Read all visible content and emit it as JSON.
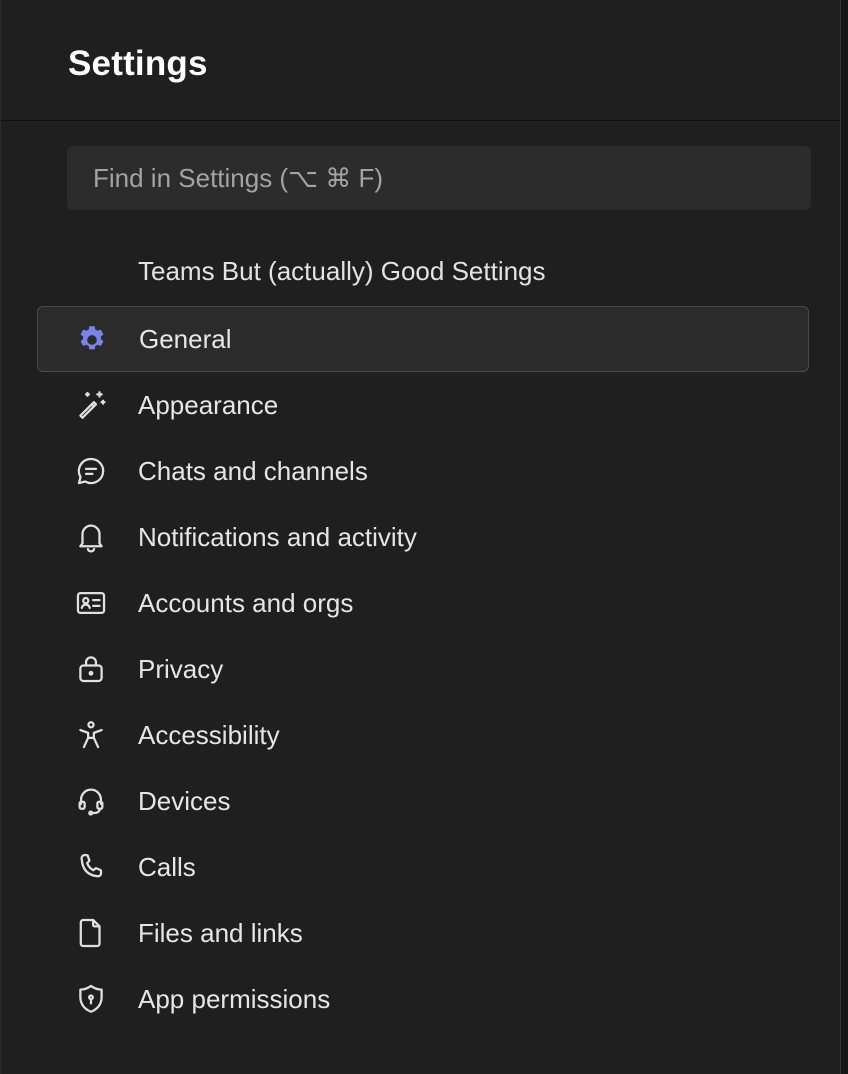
{
  "header": {
    "title": "Settings"
  },
  "search": {
    "placeholder": "Find in Settings (⌥ ⌘ F)"
  },
  "section": {
    "label": "Teams But (actually) Good Settings"
  },
  "accent_color": "#7b83eb",
  "nav": {
    "items": [
      {
        "label": "General",
        "icon": "gear-icon",
        "selected": true
      },
      {
        "label": "Appearance",
        "icon": "magic-wand-icon",
        "selected": false
      },
      {
        "label": "Chats and channels",
        "icon": "chat-bubble-icon",
        "selected": false
      },
      {
        "label": "Notifications and activity",
        "icon": "bell-icon",
        "selected": false
      },
      {
        "label": "Accounts and orgs",
        "icon": "contact-card-icon",
        "selected": false
      },
      {
        "label": "Privacy",
        "icon": "lock-icon",
        "selected": false
      },
      {
        "label": "Accessibility",
        "icon": "accessibility-icon",
        "selected": false
      },
      {
        "label": "Devices",
        "icon": "headset-icon",
        "selected": false
      },
      {
        "label": "Calls",
        "icon": "phone-icon",
        "selected": false
      },
      {
        "label": "Files and links",
        "icon": "document-icon",
        "selected": false
      },
      {
        "label": "App permissions",
        "icon": "shield-icon",
        "selected": false
      }
    ]
  }
}
